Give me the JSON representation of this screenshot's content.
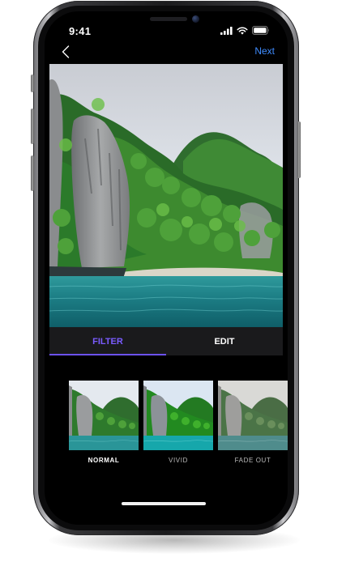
{
  "status_bar": {
    "time": "9:41",
    "signal_icon": "cellular-signal-icon",
    "wifi_icon": "wifi-icon",
    "battery_icon": "battery-icon"
  },
  "nav": {
    "back_icon": "chevron-left-icon",
    "next_label": "Next",
    "accent_color": "#3f8cff"
  },
  "tabs": [
    {
      "label": "FILTER",
      "active": true,
      "color": "#7a5cff"
    },
    {
      "label": "EDIT",
      "active": false,
      "color": "#ffffff"
    }
  ],
  "filters": [
    {
      "label": "NORMAL",
      "selected": true
    },
    {
      "label": "VIVID",
      "selected": false
    },
    {
      "label": "FADE OUT",
      "selected": false
    }
  ]
}
